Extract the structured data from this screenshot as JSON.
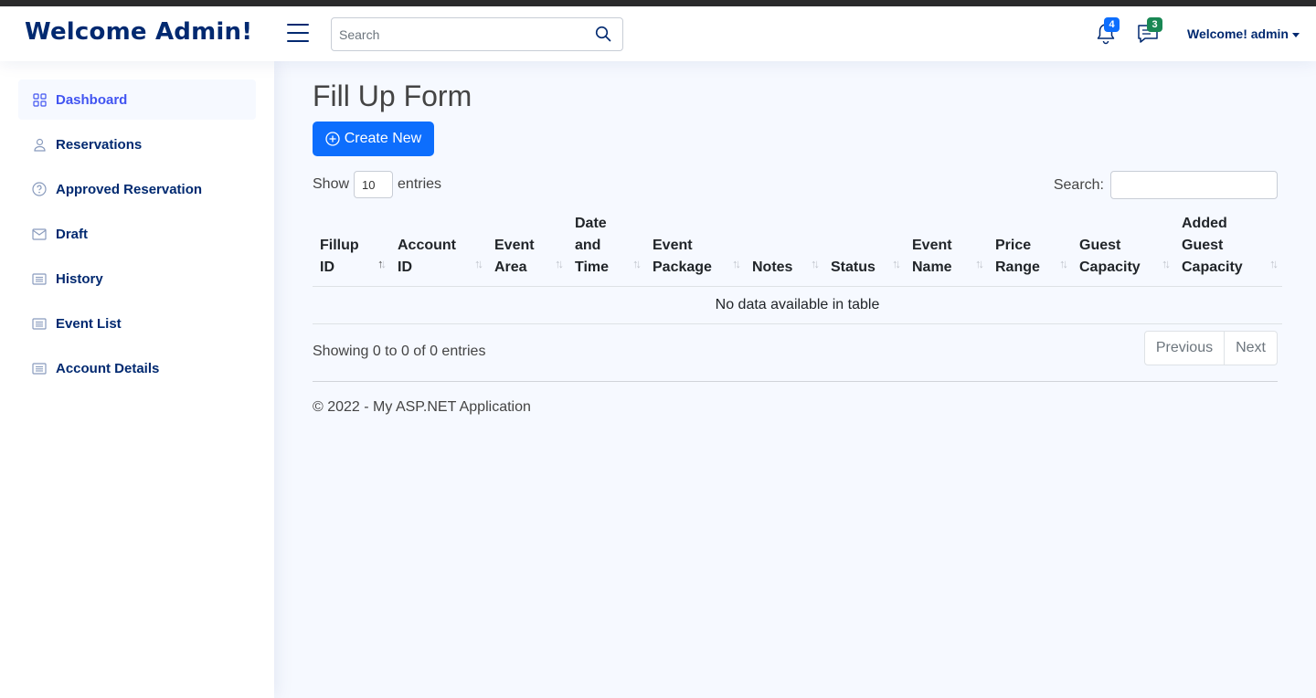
{
  "header": {
    "brand": "Welcome Admin!",
    "search_placeholder": "Search",
    "notifications_count": "4",
    "messages_count": "3",
    "profile_label": "Welcome! admin"
  },
  "sidebar": {
    "items": [
      {
        "label": "Dashboard",
        "icon": "grid-icon",
        "active": true
      },
      {
        "label": "Reservations",
        "icon": "person-icon"
      },
      {
        "label": "Approved Reservation",
        "icon": "question-circle-icon"
      },
      {
        "label": "Draft",
        "icon": "envelope-icon"
      },
      {
        "label": "History",
        "icon": "card-list-icon"
      },
      {
        "label": "Event List",
        "icon": "card-list-icon"
      },
      {
        "label": "Account Details",
        "icon": "card-list-icon"
      }
    ]
  },
  "main": {
    "title": "Fill Up Form",
    "create_label": "Create New",
    "length": {
      "show": "Show",
      "value": "10",
      "entries": "entries"
    },
    "filter_label": "Search:",
    "columns": [
      "Fillup ID",
      "Account ID",
      "Event Area",
      "Date and Time",
      "Event Package",
      "Notes",
      "Status",
      "Event Name",
      "Price Range",
      "Guest Capacity",
      "Added Guest Capacity"
    ],
    "empty_text": "No data available in table",
    "info": "Showing 0 to 0 of 0 entries",
    "pager": {
      "previous": "Previous",
      "next": "Next"
    },
    "footer": "© 2022 - My ASP.NET Application"
  },
  "colors": {
    "brand": "#012970",
    "accent": "#4154f1",
    "primary": "#0d6efd",
    "success": "#198754",
    "background": "#f6f9ff"
  }
}
